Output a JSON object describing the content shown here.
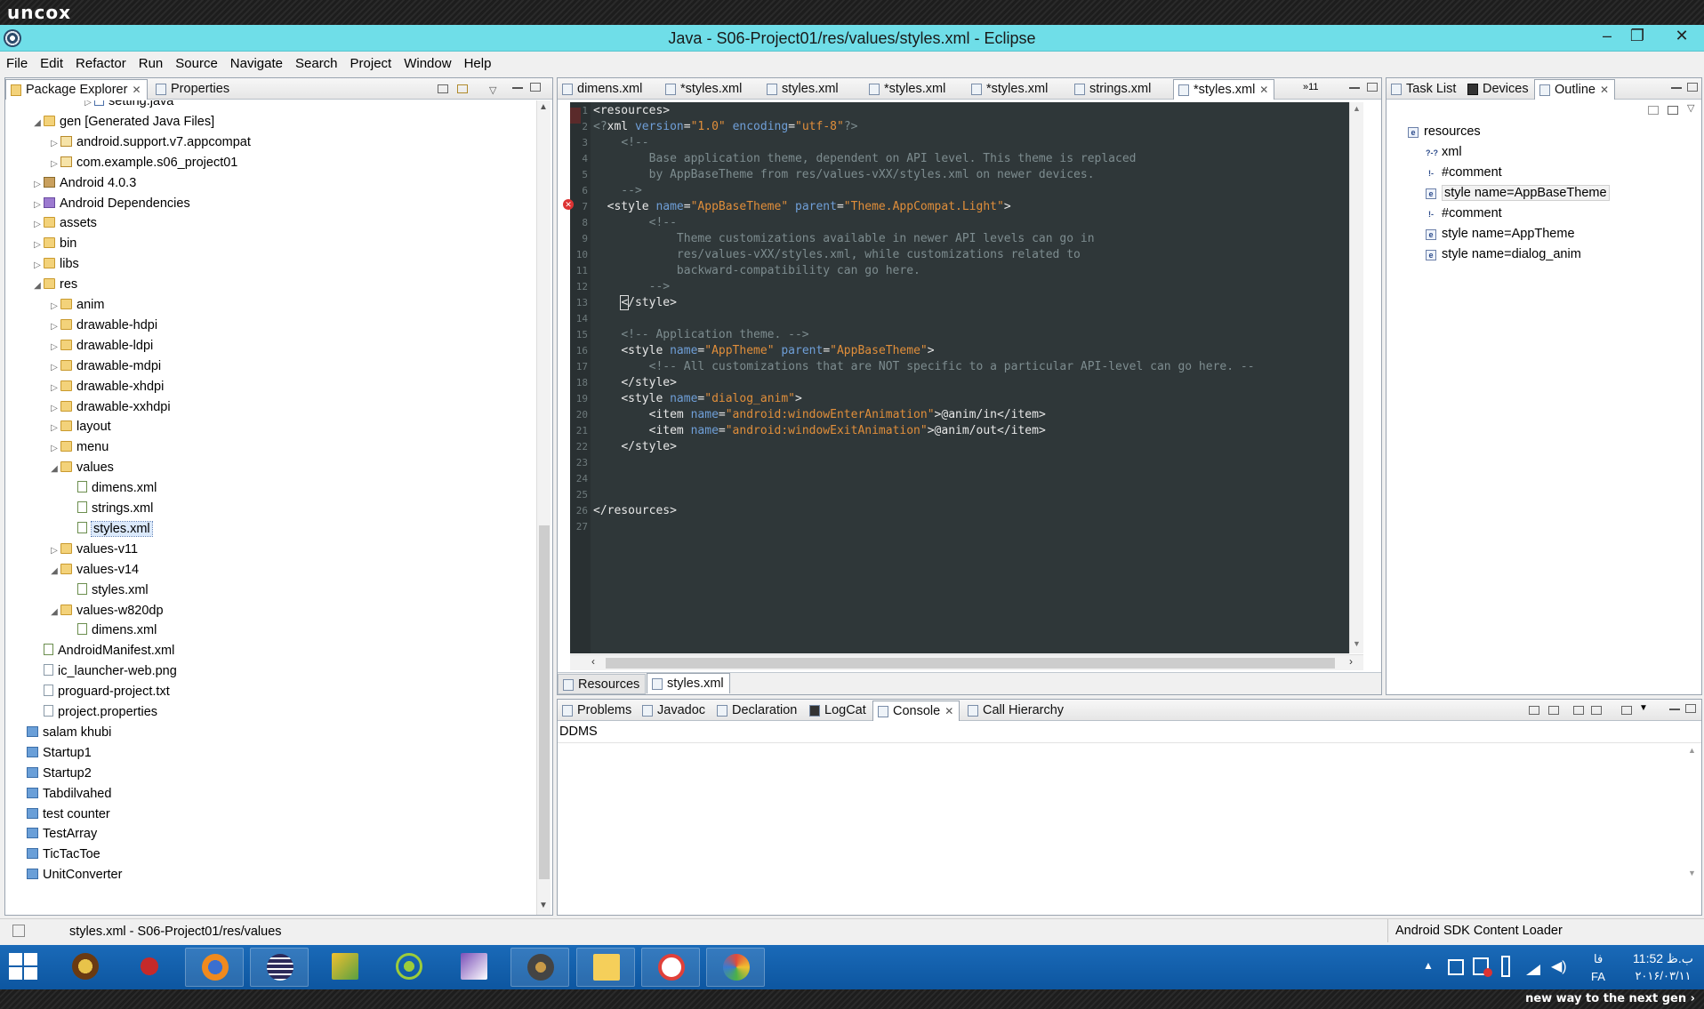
{
  "brand": {
    "logo": "uncox",
    "tagline": "new way to the next gen ›"
  },
  "window": {
    "title": "Java - S06-Project01/res/values/styles.xml - Eclipse",
    "minimize": "–",
    "maximize": "❐",
    "close": "✕"
  },
  "menu": [
    "File",
    "Edit",
    "Refactor",
    "Run",
    "Source",
    "Navigate",
    "Search",
    "Project",
    "Window",
    "Help"
  ],
  "explorer": {
    "tabs": [
      {
        "label": "Package Explorer",
        "close": "✕"
      },
      {
        "label": "Properties"
      }
    ],
    "items": [
      {
        "label": "setting.java",
        "indent": 5,
        "twisty": "▷",
        "icon": "java"
      },
      {
        "label": "gen [Generated Java Files]",
        "indent": 2,
        "twisty": "◢",
        "icon": "folder"
      },
      {
        "label": "android.support.v7.appcompat",
        "indent": 3,
        "twisty": "▷",
        "icon": "pkg"
      },
      {
        "label": "com.example.s06_project01",
        "indent": 3,
        "twisty": "▷",
        "icon": "pkg"
      },
      {
        "label": "Android 4.0.3",
        "indent": 2,
        "twisty": "▷",
        "icon": "jar"
      },
      {
        "label": "Android Dependencies",
        "indent": 2,
        "twisty": "▷",
        "icon": "lib"
      },
      {
        "label": "assets",
        "indent": 2,
        "twisty": "▷",
        "icon": "folder"
      },
      {
        "label": "bin",
        "indent": 2,
        "twisty": "▷",
        "icon": "folder"
      },
      {
        "label": "libs",
        "indent": 2,
        "twisty": "▷",
        "icon": "folder"
      },
      {
        "label": "res",
        "indent": 2,
        "twisty": "◢",
        "icon": "folder"
      },
      {
        "label": "anim",
        "indent": 3,
        "twisty": "▷",
        "icon": "folder"
      },
      {
        "label": "drawable-hdpi",
        "indent": 3,
        "twisty": "▷",
        "icon": "folder"
      },
      {
        "label": "drawable-ldpi",
        "indent": 3,
        "twisty": "▷",
        "icon": "folder"
      },
      {
        "label": "drawable-mdpi",
        "indent": 3,
        "twisty": "▷",
        "icon": "folder"
      },
      {
        "label": "drawable-xhdpi",
        "indent": 3,
        "twisty": "▷",
        "icon": "folder"
      },
      {
        "label": "drawable-xxhdpi",
        "indent": 3,
        "twisty": "▷",
        "icon": "folder"
      },
      {
        "label": "layout",
        "indent": 3,
        "twisty": "▷",
        "icon": "folder"
      },
      {
        "label": "menu",
        "indent": 3,
        "twisty": "▷",
        "icon": "folder"
      },
      {
        "label": "values",
        "indent": 3,
        "twisty": "◢",
        "icon": "folder"
      },
      {
        "label": "dimens.xml",
        "indent": 4,
        "twisty": "",
        "icon": "xml"
      },
      {
        "label": "strings.xml",
        "indent": 4,
        "twisty": "",
        "icon": "xml"
      },
      {
        "label": "styles.xml",
        "indent": 4,
        "twisty": "",
        "icon": "xml",
        "selected": true
      },
      {
        "label": "values-v11",
        "indent": 3,
        "twisty": "▷",
        "icon": "folder"
      },
      {
        "label": "values-v14",
        "indent": 3,
        "twisty": "◢",
        "icon": "folder"
      },
      {
        "label": "styles.xml",
        "indent": 4,
        "twisty": "",
        "icon": "xml"
      },
      {
        "label": "values-w820dp",
        "indent": 3,
        "twisty": "◢",
        "icon": "folder"
      },
      {
        "label": "dimens.xml",
        "indent": 4,
        "twisty": "",
        "icon": "xml"
      },
      {
        "label": "AndroidManifest.xml",
        "indent": 2,
        "twisty": "",
        "icon": "xml"
      },
      {
        "label": "ic_launcher-web.png",
        "indent": 2,
        "twisty": "",
        "icon": "file"
      },
      {
        "label": "proguard-project.txt",
        "indent": 2,
        "twisty": "",
        "icon": "file"
      },
      {
        "label": "project.properties",
        "indent": 2,
        "twisty": "",
        "icon": "file"
      },
      {
        "label": "salam khubi",
        "indent": 1,
        "twisty": "",
        "icon": "proj"
      },
      {
        "label": "Startup1",
        "indent": 1,
        "twisty": "",
        "icon": "proj"
      },
      {
        "label": "Startup2",
        "indent": 1,
        "twisty": "",
        "icon": "proj"
      },
      {
        "label": "Tabdilvahed",
        "indent": 1,
        "twisty": "",
        "icon": "proj"
      },
      {
        "label": "test counter",
        "indent": 1,
        "twisty": "",
        "icon": "proj"
      },
      {
        "label": "TestArray",
        "indent": 1,
        "twisty": "",
        "icon": "proj"
      },
      {
        "label": "TicTacToe",
        "indent": 1,
        "twisty": "",
        "icon": "proj"
      },
      {
        "label": "UnitConverter",
        "indent": 1,
        "twisty": "",
        "icon": "proj"
      }
    ]
  },
  "editor": {
    "tabs": [
      "dimens.xml",
      "*styles.xml",
      "styles.xml",
      "*styles.xml",
      "*styles.xml",
      "strings.xml",
      "*styles.xml"
    ],
    "active_tab_close": "✕",
    "overflow": "»11",
    "line_numbers": [
      "1",
      "2",
      "3",
      "4",
      "5",
      "6",
      "7",
      "8",
      "9",
      "10",
      "11",
      "12",
      "13",
      "14",
      "15",
      "16",
      "17",
      "18",
      "19",
      "20",
      "21",
      "22",
      "23",
      "24",
      "25",
      "26",
      "27"
    ],
    "bottom_tabs": [
      "Resources",
      "styles.xml"
    ]
  },
  "outline": {
    "tabs": [
      "Task List",
      "Devices",
      "Outline"
    ],
    "close": "✕",
    "items": [
      {
        "label": "resources",
        "indent": 0,
        "icon": "e"
      },
      {
        "label": "xml",
        "indent": 1,
        "icon": "?-?"
      },
      {
        "label": "#comment",
        "indent": 1,
        "icon": "!-"
      },
      {
        "label": "style name=AppBaseTheme",
        "indent": 1,
        "icon": "e",
        "selected": true
      },
      {
        "label": "#comment",
        "indent": 1,
        "icon": "!-"
      },
      {
        "label": "style name=AppTheme",
        "indent": 1,
        "icon": "e"
      },
      {
        "label": "style name=dialog_anim",
        "indent": 1,
        "icon": "e"
      }
    ]
  },
  "console": {
    "tabs": [
      "Problems",
      "Javadoc",
      "Declaration",
      "LogCat",
      "Console",
      "Call Hierarchy"
    ],
    "active": "Console",
    "close": "✕",
    "header": "DDMS"
  },
  "statusbar": {
    "left": "styles.xml - S06-Project01/res/values",
    "right": "Android SDK Content Loader"
  },
  "taskbar": {
    "clock_time": "11:52 ب.ظ",
    "clock_date": "۲۰۱۶/۰۳/۱۱",
    "lang_top": "فا",
    "lang": "FA"
  },
  "colors": {
    "titlebar": "#6fdee8",
    "editor_bg": "#2f3739",
    "taskbar": "#1565b3"
  }
}
